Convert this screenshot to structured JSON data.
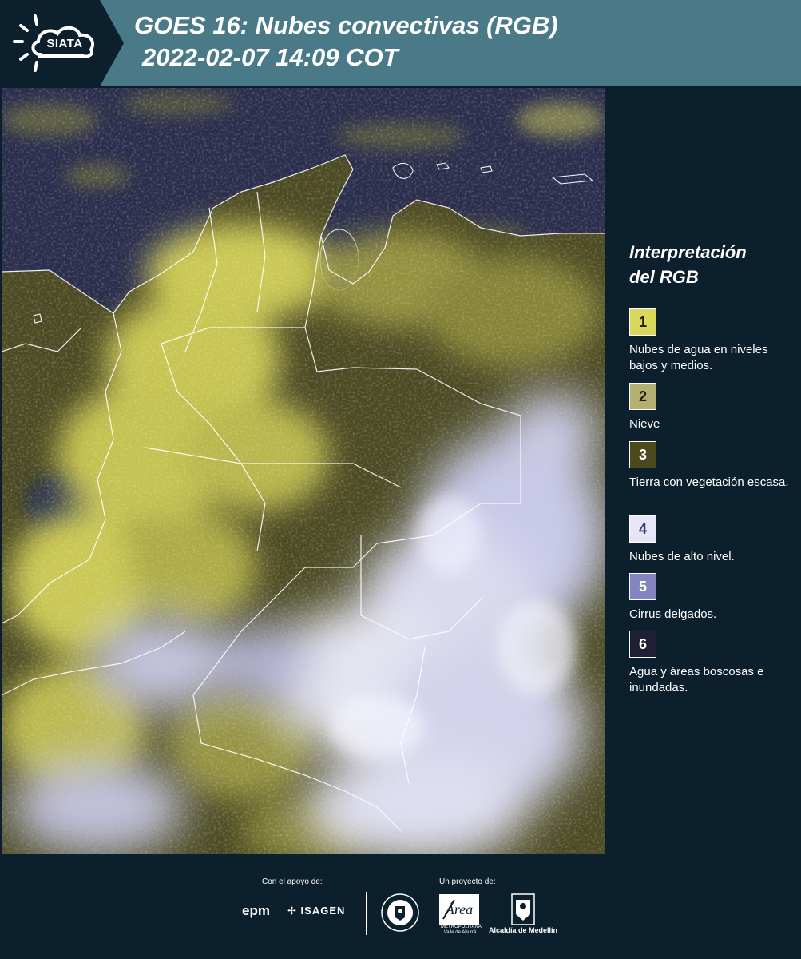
{
  "header": {
    "logo_text": "SIATA",
    "title": "GOES 16: Nubes convectivas (RGB)",
    "subtitle": "2022-02-07 14:09 COT"
  },
  "map": {
    "product": "GOES 16 convective clouds RGB composite",
    "palette": {
      "water_background": "#2a2d4e",
      "low_mid_cloud": "#e8e66a",
      "land_dark": "#4f4f26",
      "high_cloud": "#e9e6fa",
      "thin_cirrus": "#8f8ec8",
      "borders": "#ffffff"
    }
  },
  "legend": {
    "title_line1": "Interpretación",
    "title_line2": "del RGB",
    "items": [
      {
        "number": "1",
        "color": "#d9d85a",
        "text_color": "#1b1b0a",
        "label": "Nubes de agua en niveles bajos y medios."
      },
      {
        "number": "2",
        "color": "#b3b072",
        "text_color": "#1b1b0a",
        "label": "Nieve"
      },
      {
        "number": "3",
        "color": "#4c4a1c",
        "text_color": "#ffffff",
        "label": "Tierra con vegetación escasa."
      },
      {
        "number": "4",
        "color": "#e6e6f6",
        "text_color": "#3a3a6a",
        "label": "Nubes de alto nivel."
      },
      {
        "number": "5",
        "color": "#8384c0",
        "text_color": "#ffffff",
        "label": "Cirrus delgados."
      },
      {
        "number": "6",
        "color": "#1e1e34",
        "text_color": "#ffffff",
        "label": "Agua y áreas boscosas e inundadas."
      }
    ]
  },
  "footer": {
    "support_label": "Con el apoyo de:",
    "project_label": "Un proyecto de:",
    "sponsors": [
      "epm",
      "ISAGEN"
    ],
    "area_caption": "METROPOLITANA Valle de Aburrá",
    "alcaldia": "Alcaldía de Medellín"
  }
}
